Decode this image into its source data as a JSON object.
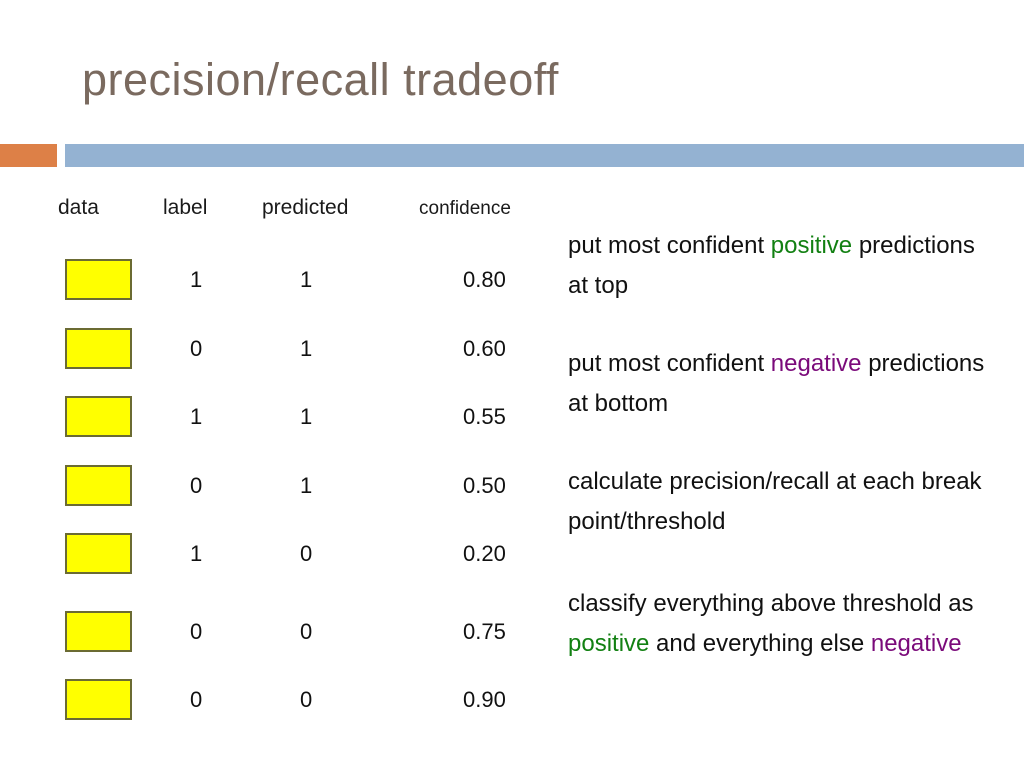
{
  "slide": {
    "title": "precision/recall tradeoff",
    "title_color": "#7a6a5f",
    "accent_orange": "#dd8047",
    "accent_blue": "#94b2d2"
  },
  "table": {
    "headers": {
      "data": "data",
      "label": "label",
      "predicted": "predicted",
      "confidence": "confidence"
    },
    "swatch_color": "#ffff00",
    "swatch_border": "#6b6b33",
    "rows": [
      {
        "data": "",
        "label": "1",
        "predicted": "1",
        "confidence": "0.80"
      },
      {
        "data": "",
        "label": "0",
        "predicted": "1",
        "confidence": "0.60"
      },
      {
        "data": "",
        "label": "1",
        "predicted": "1",
        "confidence": "0.55"
      },
      {
        "data": "",
        "label": "0",
        "predicted": "1",
        "confidence": "0.50"
      },
      {
        "data": "",
        "label": "1",
        "predicted": "0",
        "confidence": "0.20"
      },
      {
        "data": "",
        "label": "0",
        "predicted": "0",
        "confidence": "0.75"
      },
      {
        "data": "",
        "label": "0",
        "predicted": "0",
        "confidence": "0.90"
      }
    ]
  },
  "notes": {
    "positive_color": "#128012",
    "negative_color": "#7a0a7a",
    "block1": {
      "pre": "put most confident ",
      "highlight": "positive",
      "post": " predictions at top"
    },
    "block2": {
      "pre": "put most confident ",
      "highlight": "negative",
      "post": " predictions at bottom"
    },
    "block3": {
      "text": "calculate precision/recall at each break point/threshold"
    },
    "block4": {
      "pre": "classify everything above threshold as ",
      "highlight1": "positive",
      "mid": " and everything else ",
      "highlight2": "negative"
    }
  }
}
